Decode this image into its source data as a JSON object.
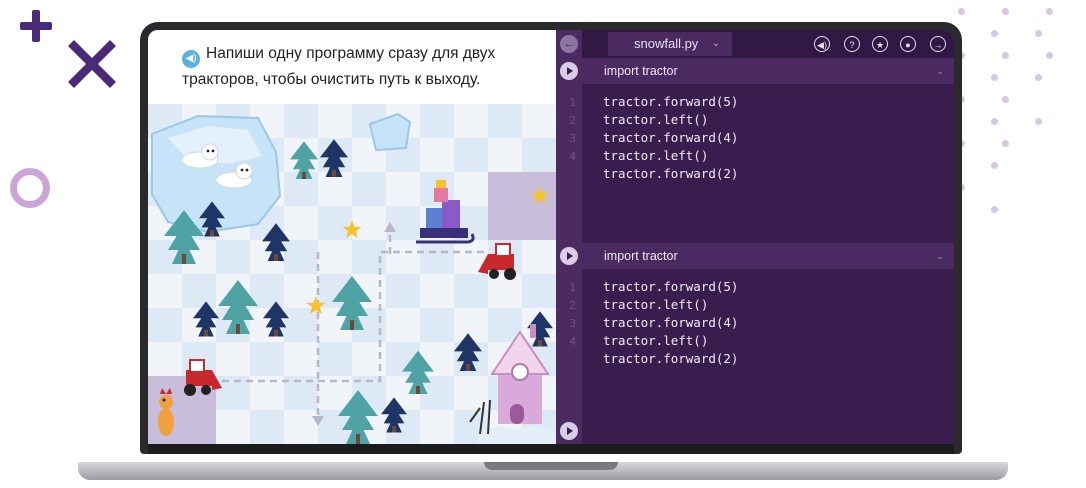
{
  "task": {
    "text": "Напиши одну программу сразу для двух тракторов, чтобы очистить путь к выходу."
  },
  "toolbar": {
    "file_name": "snowfall.py",
    "icons": [
      "back-icon",
      "sound-icon",
      "help-icon",
      "star-icon",
      "location-icon",
      "exit-icon"
    ]
  },
  "editors": [
    {
      "header": "import tractor",
      "lines": [
        {
          "no": "1",
          "code": "tractor.forward(5)"
        },
        {
          "no": "2",
          "code": "tractor.left()"
        },
        {
          "no": "3",
          "code": "tractor.forward(4)"
        },
        {
          "no": "4",
          "code": "tractor.left()"
        },
        {
          "no": "",
          "code": "tractor.forward(2)"
        }
      ]
    },
    {
      "header": "import tractor",
      "lines": [
        {
          "no": "1",
          "code": "tractor.forward(5)"
        },
        {
          "no": "2",
          "code": "tractor.left()"
        },
        {
          "no": "3",
          "code": "tractor.forward(4)"
        },
        {
          "no": "4",
          "code": "tractor.left()"
        },
        {
          "no": "",
          "code": "tractor.forward(2)"
        }
      ]
    }
  ],
  "colors": {
    "code_bg": "#3a1d4f",
    "accent_purple": "#4a2a7a",
    "tile_light": "#f1f5fa",
    "tile_blue": "#dde9f4",
    "tile_purple": "#c8bedc",
    "tree_teal": "#4fa3a5",
    "tree_navy": "#1f3566",
    "star": "#f6c12c",
    "tractor_red": "#c8282e"
  }
}
